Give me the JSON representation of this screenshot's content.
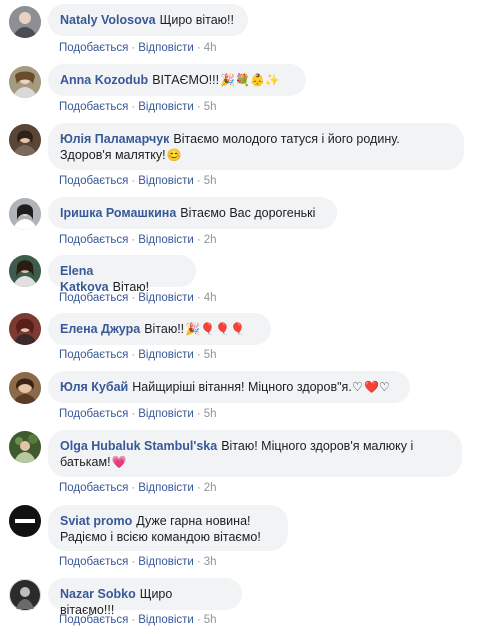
{
  "comments": [
    {
      "author": "Nataly Volosova",
      "text": "Щиро вітаю!!",
      "emoji": "",
      "like": "Подобається",
      "reply": "Відповісти",
      "time": "4h",
      "avatar_color": "#8d8f95"
    },
    {
      "author": "Anna Kozodub",
      "text": "ВІТАЄМО!!!",
      "emoji": "🎉💐👶✨",
      "like": "Подобається",
      "reply": "Відповісти",
      "time": "5h",
      "avatar_color": "#a49a7e"
    },
    {
      "author": "Юлія Паламарчук",
      "text": "Вітаємо молодого татуся і його родину. Здоров'я малятку!",
      "emoji": "😊",
      "like": "Подобається",
      "reply": "Відповісти",
      "time": "5h",
      "avatar_color": "#5a4636"
    },
    {
      "author": "Іришка Ромашкина",
      "text": "Вітаємо Вас дорогенькі",
      "emoji": "",
      "like": "Подобається",
      "reply": "Відповісти",
      "time": "2h",
      "avatar_color": "#6a6d73"
    },
    {
      "author": "Elena Katkova",
      "text": "Вітаю!",
      "emoji": "",
      "like": "Подобається",
      "reply": "Відповісти",
      "time": "4h",
      "avatar_color": "#3d5d4c"
    },
    {
      "author": "Елена Джура",
      "text": "Вітаю!!",
      "emoji": "🎉🎈🎈🎈",
      "like": "Подобається",
      "reply": "Відповісти",
      "time": "5h",
      "avatar_color": "#7c3a33"
    },
    {
      "author": "Юля Кубай",
      "text": "Найщиріші вітання! Міцного здоров\"я.♡",
      "emoji": "❤️♡",
      "like": "Подобається",
      "reply": "Відповісти",
      "time": "5h",
      "avatar_color": "#8a6a4a"
    },
    {
      "author": "Olga Hubaluk Stambul'ska",
      "text": "Вітаю! Міцного здоров'я малюку і батькам!",
      "emoji": "💗",
      "like": "Подобається",
      "reply": "Відповісти",
      "time": "2h",
      "avatar_color": "#3e5a2e"
    },
    {
      "author": "Sviat promo",
      "text": "Дуже гарна новина! Радіємо і всією командою вітаємо!",
      "emoji": "",
      "like": "Подобається",
      "reply": "Відповісти",
      "time": "3h",
      "avatar_color": "#111111"
    },
    {
      "author": "Nazar Sobko",
      "text": "Щиро вітаємо!!!",
      "emoji": "",
      "like": "Подобається",
      "reply": "Відповісти",
      "time": "5h",
      "avatar_color": "#2b2b2b"
    }
  ]
}
